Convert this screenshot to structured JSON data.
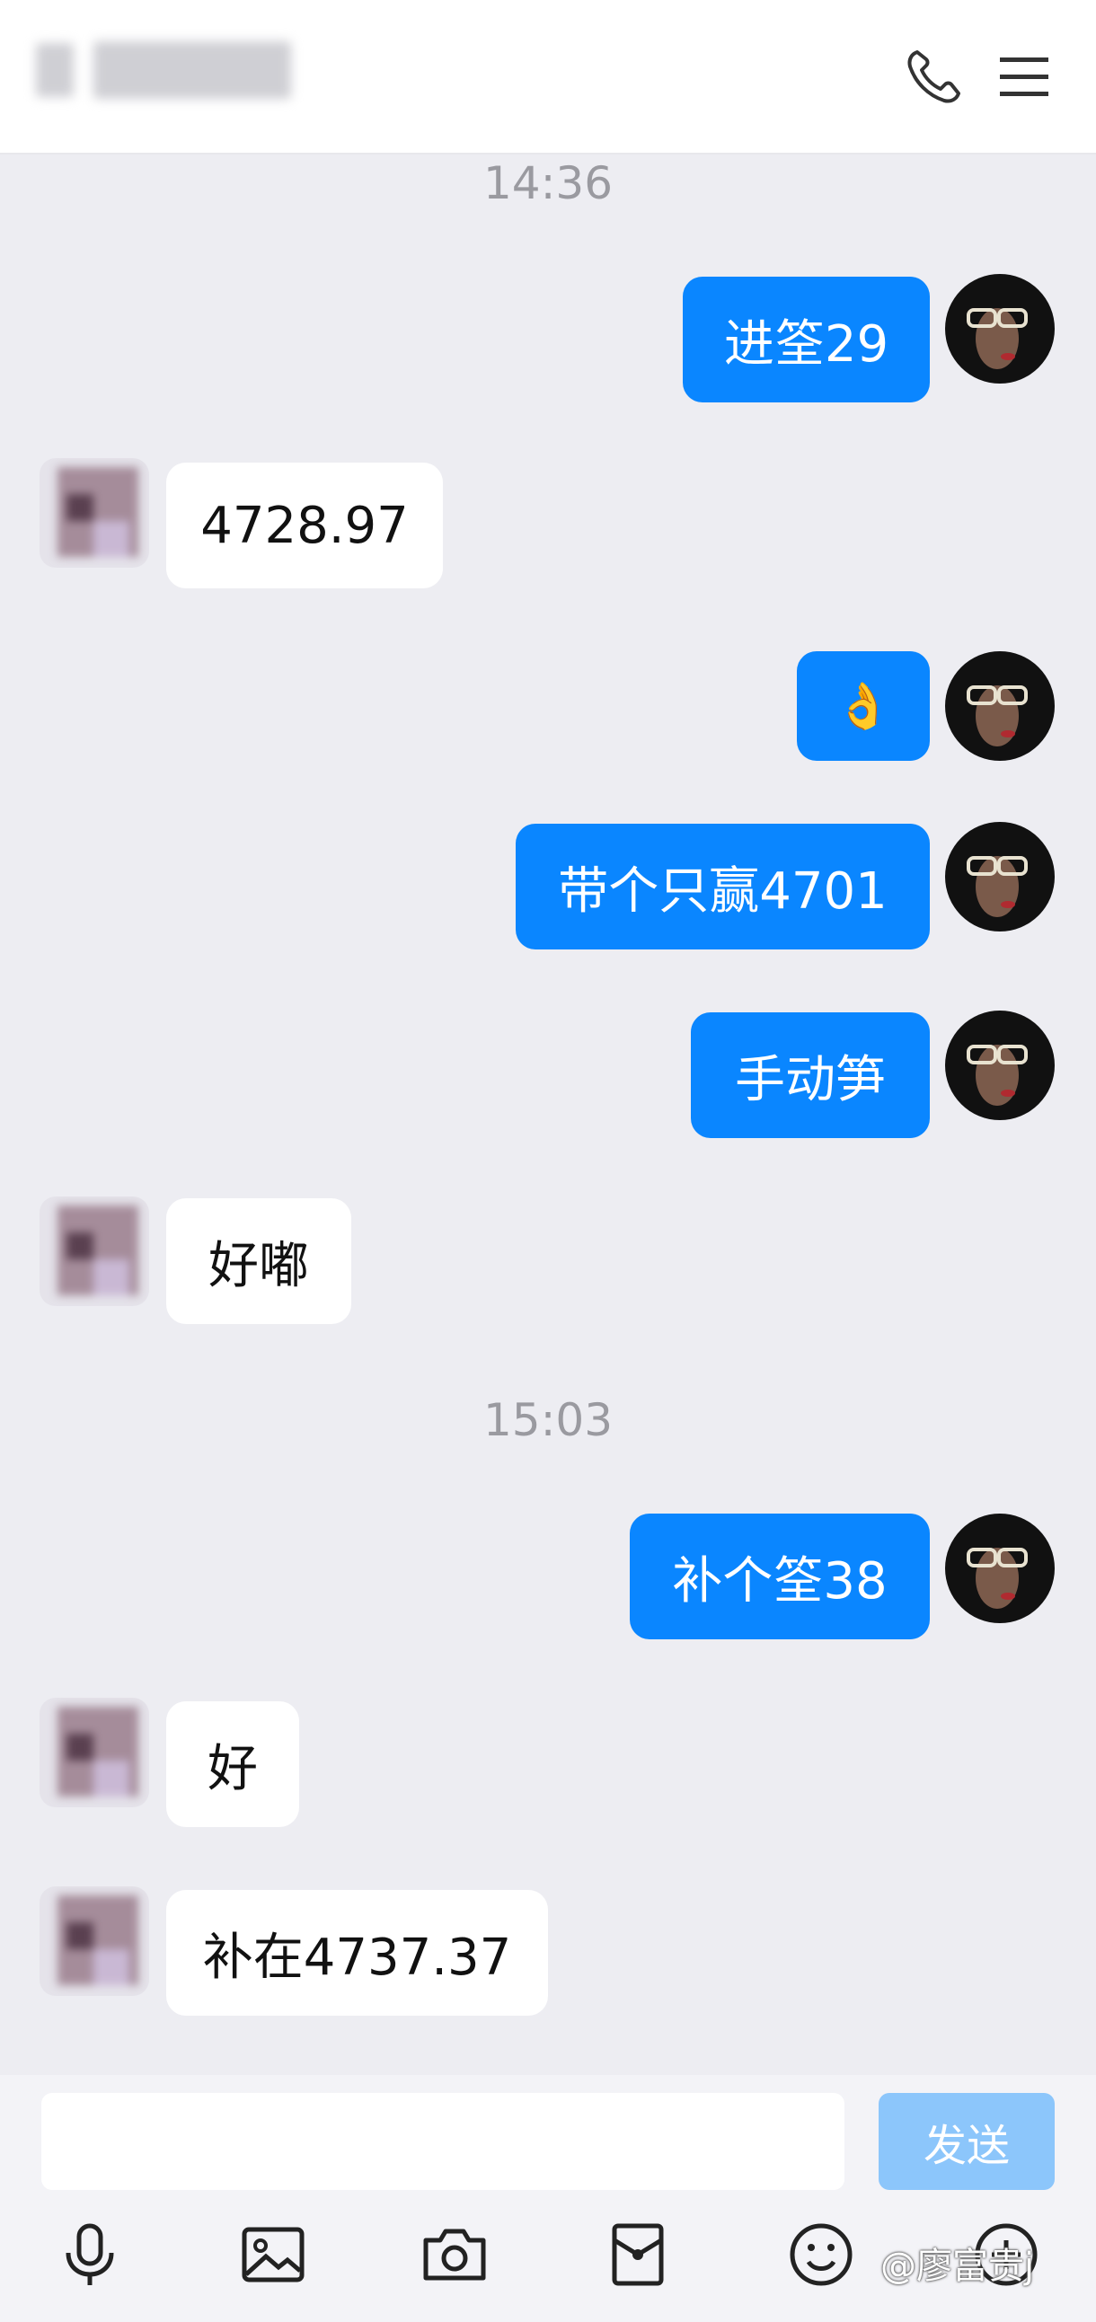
{
  "header": {
    "call_icon": "phone-icon",
    "menu_icon": "hamburger-menu-icon"
  },
  "messages": [
    {
      "type": "time",
      "text": "14:36"
    },
    {
      "type": "me",
      "text": "进筌29"
    },
    {
      "type": "other",
      "text": "4728.97"
    },
    {
      "type": "me",
      "text": "👌"
    },
    {
      "type": "me",
      "text": "带个只赢4701"
    },
    {
      "type": "me",
      "text": "手动笋"
    },
    {
      "type": "other",
      "text": "好嘟"
    },
    {
      "type": "time",
      "text": "15:03"
    },
    {
      "type": "me",
      "text": "补个筌38"
    },
    {
      "type": "other",
      "text": "好"
    },
    {
      "type": "other",
      "text": "补在4737.37"
    }
  ],
  "composer": {
    "input_value": "",
    "send_label": "发送"
  },
  "toolbar": {
    "icons": [
      "microphone-icon",
      "image-icon",
      "camera-icon",
      "red-packet-icon",
      "emoji-icon",
      "plus-icon"
    ]
  },
  "watermark": "@廖富贵j",
  "colors": {
    "my_bubble": "#0a86ff",
    "other_bubble": "#ffffff",
    "background": "#ededf2",
    "send_button_disabled": "#8cc6fb"
  }
}
